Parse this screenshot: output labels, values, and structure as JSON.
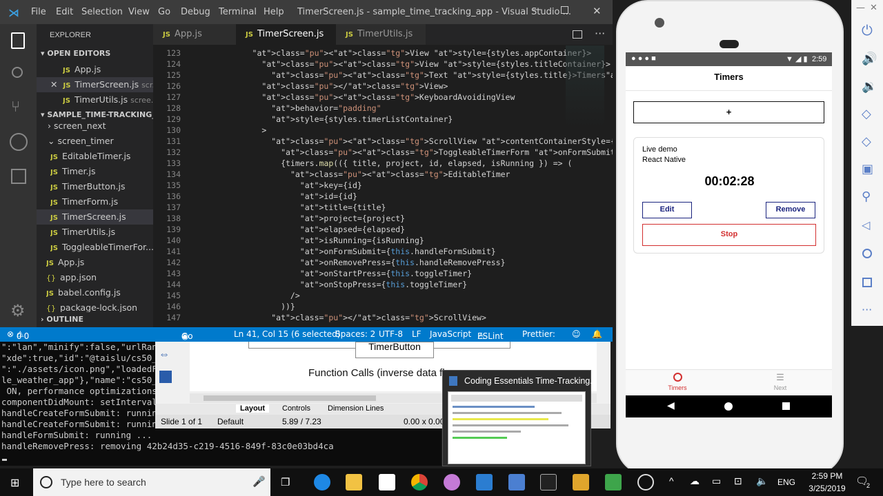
{
  "vscode": {
    "title": "TimerScreen.js - sample_time_tracking_app - Visual Studio ...",
    "menu": [
      "File",
      "Edit",
      "Selection",
      "View",
      "Go",
      "Debug",
      "Terminal",
      "Help"
    ],
    "explorer_label": "EXPLORER",
    "open_editors_label": "OPEN EDITORS",
    "open_editors": [
      {
        "name": "App.js",
        "path": ""
      },
      {
        "name": "TimerScreen.js",
        "path": "scr..."
      },
      {
        "name": "TimerUtils.js",
        "path": "scree..."
      }
    ],
    "project_label": "SAMPLE_TIME-TRACKING_...",
    "files": [
      {
        "name": "screen_next",
        "type": "folder"
      },
      {
        "name": "screen_timer",
        "type": "folder"
      },
      {
        "name": "EditableTimer.js",
        "type": "js"
      },
      {
        "name": "Timer.js",
        "type": "js"
      },
      {
        "name": "TimerButton.js",
        "type": "js"
      },
      {
        "name": "TimerForm.js",
        "type": "js"
      },
      {
        "name": "TimerScreen.js",
        "type": "js"
      },
      {
        "name": "TimerUtils.js",
        "type": "js"
      },
      {
        "name": "ToggleableTimerFor...",
        "type": "js"
      },
      {
        "name": "App.js",
        "type": "js"
      },
      {
        "name": "app.json",
        "type": "json"
      },
      {
        "name": "babel.config.js",
        "type": "js"
      },
      {
        "name": "package-lock.json",
        "type": "json"
      }
    ],
    "outline_label": "OUTLINE",
    "tabs": [
      "App.js",
      "TimerScreen.js",
      "TimerUtils.js"
    ],
    "code_lines": [
      {
        "n": "123",
        "t": "      <View style={styles.appContainer}>"
      },
      {
        "n": "124",
        "t": "        <View style={styles.titleContainer}>"
      },
      {
        "n": "125",
        "t": "          <Text style={styles.title}>Timers</Text>"
      },
      {
        "n": "126",
        "t": "        </View>"
      },
      {
        "n": "127",
        "t": "        <KeyboardAvoidingView"
      },
      {
        "n": "128",
        "t": "          behavior=\"padding\""
      },
      {
        "n": "129",
        "t": "          style={styles.timerListContainer}"
      },
      {
        "n": "130",
        "t": "        >"
      },
      {
        "n": "131",
        "t": "          <ScrollView contentContainerStyle={styles.timerList}>"
      },
      {
        "n": "132",
        "t": "            <ToggleableTimerForm onFormSubmit={this.handleCreateFormSubmit} />"
      },
      {
        "n": "133",
        "t": "            {timers.map(({ title, project, id, elapsed, isRunning }) => ("
      },
      {
        "n": "134",
        "t": "              <EditableTimer"
      },
      {
        "n": "135",
        "t": "                key={id}"
      },
      {
        "n": "136",
        "t": "                id={id}"
      },
      {
        "n": "137",
        "t": "                title={title}"
      },
      {
        "n": "138",
        "t": "                project={project}"
      },
      {
        "n": "139",
        "t": "                elapsed={elapsed}"
      },
      {
        "n": "140",
        "t": "                isRunning={isRunning}"
      },
      {
        "n": "141",
        "t": "                onFormSubmit={this.handleFormSubmit}"
      },
      {
        "n": "142",
        "t": "                onRemovePress={this.handleRemovePress}"
      },
      {
        "n": "143",
        "t": "                onStartPress={this.toggleTimer}"
      },
      {
        "n": "144",
        "t": "                onStopPress={this.toggleTimer}"
      },
      {
        "n": "145",
        "t": "              />"
      },
      {
        "n": "146",
        "t": "            ))}"
      },
      {
        "n": "147",
        "t": "          </ScrollView>"
      }
    ],
    "status": {
      "errors": "0",
      "warnings": "0",
      "go_live": "Go Live",
      "position": "Ln 41, Col 15 (6 selected)",
      "spaces": "Spaces: 2",
      "encoding": "UTF-8",
      "eol": "LF",
      "language": "JavaScript",
      "eslint": "ESLint",
      "prettier": "Prettier:"
    }
  },
  "terminal": {
    "lines": [
      "\":\"lan\",\"minify\":false,\"urlRan",
      "\"xde\":true,\"id\":\"@taislu/cs50_",
      "\":\"./assets/icon.png\",\"loadedF",
      "le_weather_app\"},\"name\":\"cs50_",
      " ON, performance optimizations",
      "componentDidMount: setInterval",
      "handleCreateFormSubmit: runnin",
      "handleCreateFormSubmit: runnin"
    ],
    "wide_lines": [
      "handleFormSubmit: running ...",
      "handleRemovePress: removing 42b24d35-c219-4516-849f-83c0e03bd4ca"
    ]
  },
  "impress": {
    "box_label": "TimerButton",
    "slide_text": "Function Calls (inverse data flo",
    "tabs": [
      "Layout",
      "Controls",
      "Dimension Lines"
    ],
    "slide_info": "Slide 1 of 1",
    "style": "Default",
    "coords": "5.89 / 7.23",
    "size": "0.00 x 0.00"
  },
  "popup": {
    "title": "Coding Essentials Time-Tracking..."
  },
  "phone": {
    "time": "2:59",
    "header_title": "Timers",
    "add_button": "+",
    "timer": {
      "title": "Live demo",
      "project": "React Native",
      "elapsed": "00:02:28",
      "edit": "Edit",
      "remove": "Remove",
      "stop": "Stop"
    },
    "tabs": [
      {
        "label": "Timers",
        "icon": "timer-icon",
        "active": true
      },
      {
        "label": "Next",
        "icon": "sliders-icon",
        "active": false
      }
    ]
  },
  "taskbar": {
    "search_placeholder": "Type here to search",
    "language": "ENG",
    "time": "2:59 PM",
    "date": "3/25/2019",
    "notification_count": "2"
  },
  "colors": {
    "vscode_blue": "#007acc",
    "stop_red": "#d32f2f",
    "button_blue": "#1a237e"
  }
}
